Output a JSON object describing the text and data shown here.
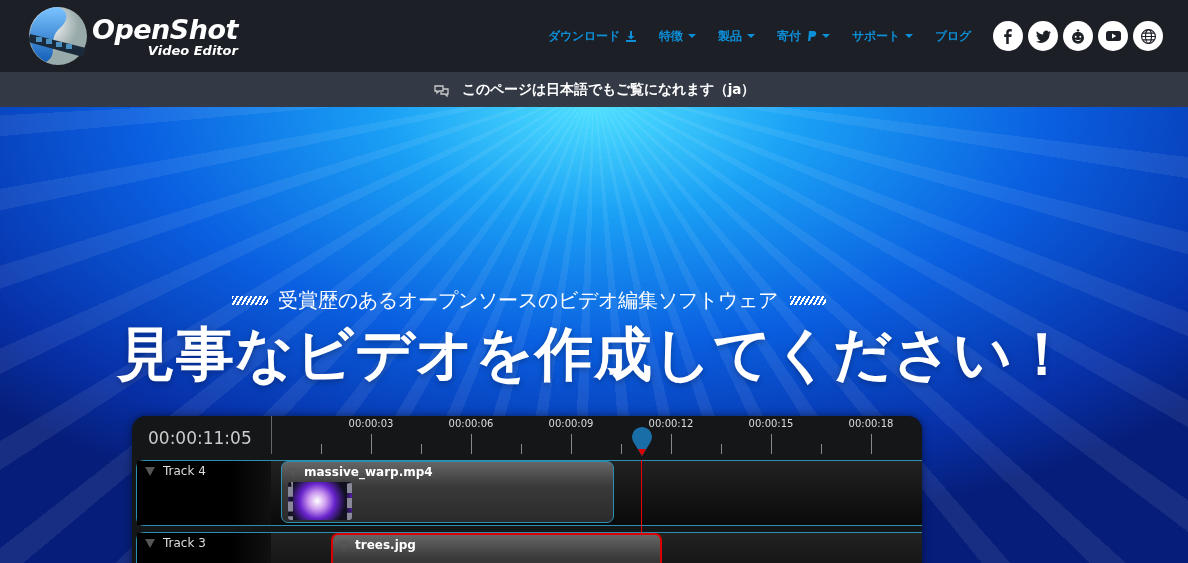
{
  "logo": {
    "name": "OpenShot",
    "tagline": "Video Editor"
  },
  "nav": [
    {
      "label": "ダウンロード",
      "kind": "download",
      "dropdown": false
    },
    {
      "label": "特徴",
      "kind": "plain",
      "dropdown": true
    },
    {
      "label": "製品",
      "kind": "plain",
      "dropdown": true
    },
    {
      "label": "寄付",
      "kind": "donate",
      "dropdown": true
    },
    {
      "label": "サポート",
      "kind": "plain",
      "dropdown": true
    },
    {
      "label": "ブログ",
      "kind": "plain",
      "dropdown": false
    }
  ],
  "social": [
    {
      "kind": "facebook"
    },
    {
      "kind": "twitter"
    },
    {
      "kind": "reddit"
    },
    {
      "kind": "youtube"
    },
    {
      "kind": "globe"
    }
  ],
  "language_notice": "このページは日本語でもご覧になれます（ja）",
  "hero": {
    "subtitle": "受賞歴のあるオープンソースのビデオ編集ソフトウェア",
    "headline": "見事なビデオを作成してください！"
  },
  "timeline": {
    "timecode": "00:00:11:05",
    "ticks": [
      "00:00:03",
      "00:00:06",
      "00:00:09",
      "00:00:12",
      "00:00:15",
      "00:00:18"
    ],
    "tracks": [
      {
        "name": "Track 4",
        "clips": [
          {
            "name": "massive_warp.mp4",
            "selected": false
          }
        ]
      },
      {
        "name": "Track 3",
        "clips": [
          {
            "name": "trees.jpg",
            "selected": true
          }
        ]
      }
    ]
  }
}
